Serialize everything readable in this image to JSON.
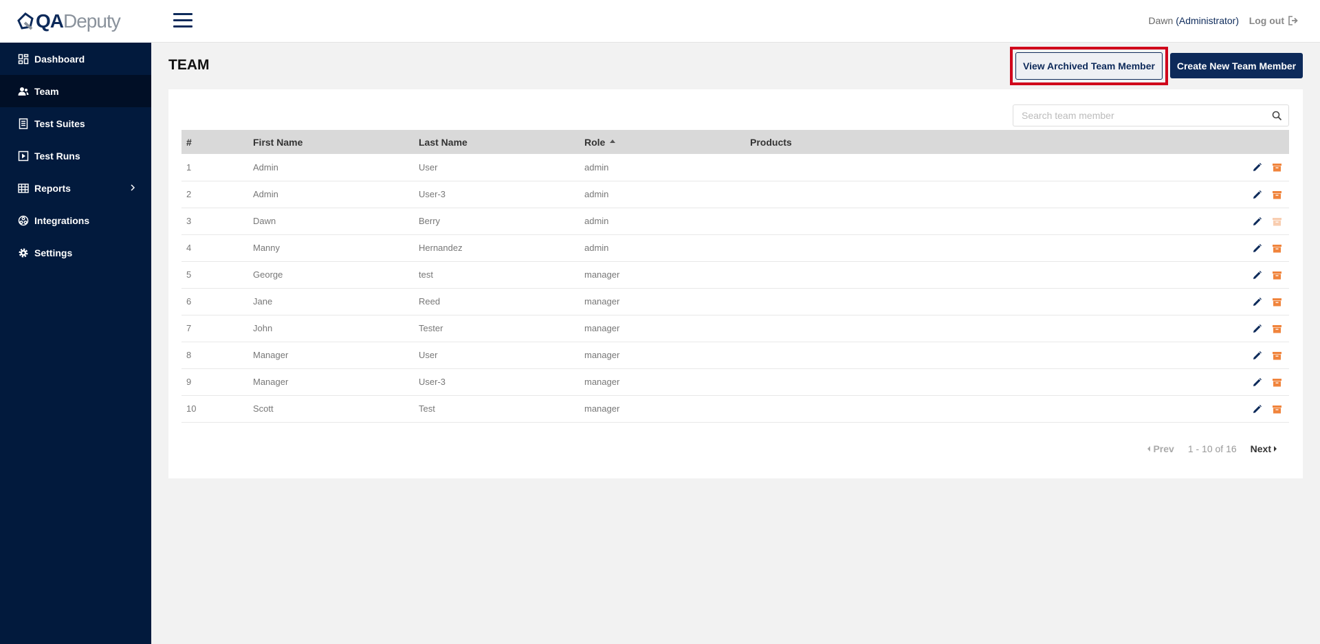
{
  "brand": {
    "bold": "QA",
    "light": "Deputy",
    "primary": "#0d2a5a",
    "sidebar_bg": "#021a3d",
    "accent": "#f0843c",
    "highlight": "#d0021b"
  },
  "sidebar": {
    "items": [
      {
        "label": "Dashboard",
        "icon": "dashboard-icon"
      },
      {
        "label": "Team",
        "icon": "team-icon",
        "active": true
      },
      {
        "label": "Test Suites",
        "icon": "test-suites-icon"
      },
      {
        "label": "Test Runs",
        "icon": "test-runs-icon"
      },
      {
        "label": "Reports",
        "icon": "reports-icon",
        "has_submenu": true
      },
      {
        "label": "Integrations",
        "icon": "integrations-icon"
      },
      {
        "label": "Settings",
        "icon": "gear-icon"
      }
    ]
  },
  "header": {
    "user_name": "Dawn",
    "user_role": "(Administrator)",
    "logout_label": "Log out"
  },
  "page": {
    "title": "TEAM",
    "archived_button": "View Archived Team Member",
    "create_button": "Create New Team Member"
  },
  "search": {
    "placeholder": "Search team member",
    "value": ""
  },
  "table": {
    "headers": {
      "num": "#",
      "first": "First Name",
      "last": "Last Name",
      "role": "Role",
      "products": "Products"
    },
    "sorted_by": "Role",
    "rows": [
      {
        "num": "1",
        "first": "Admin",
        "last": "User",
        "role": "admin",
        "products": "",
        "archive_enabled": true
      },
      {
        "num": "2",
        "first": "Admin",
        "last": "User-3",
        "role": "admin",
        "products": "",
        "archive_enabled": true
      },
      {
        "num": "3",
        "first": "Dawn",
        "last": "Berry",
        "role": "admin",
        "products": "",
        "archive_enabled": false
      },
      {
        "num": "4",
        "first": "Manny",
        "last": "Hernandez",
        "role": "admin",
        "products": "",
        "archive_enabled": true
      },
      {
        "num": "5",
        "first": "George",
        "last": "test",
        "role": "manager",
        "products": "",
        "archive_enabled": true
      },
      {
        "num": "6",
        "first": "Jane",
        "last": "Reed",
        "role": "manager",
        "products": "",
        "archive_enabled": true
      },
      {
        "num": "7",
        "first": "John",
        "last": "Tester",
        "role": "manager",
        "products": "",
        "archive_enabled": true
      },
      {
        "num": "8",
        "first": "Manager",
        "last": "User",
        "role": "manager",
        "products": "",
        "archive_enabled": true
      },
      {
        "num": "9",
        "first": "Manager",
        "last": "User-3",
        "role": "manager",
        "products": "",
        "archive_enabled": true
      },
      {
        "num": "10",
        "first": "Scott",
        "last": "Test",
        "role": "manager",
        "products": "",
        "archive_enabled": true
      }
    ]
  },
  "pagination": {
    "prev": "Prev",
    "range": "1 - 10 of 16",
    "next": "Next"
  }
}
